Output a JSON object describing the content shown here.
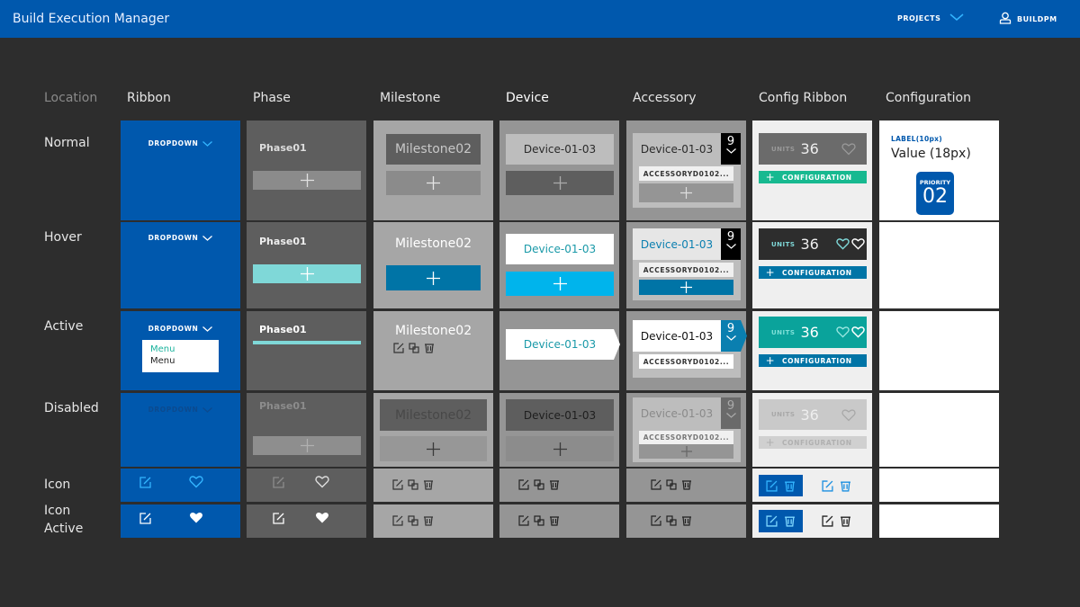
{
  "header": {
    "title": "Build Execution Manager",
    "projects_label": "PROJECTS",
    "user_label": "BUILDPM"
  },
  "columns": {
    "location": "Location",
    "ribbon": "Ribbon",
    "phase": "Phase",
    "milestone": "Milestone",
    "device": "Device",
    "accessory": "Accessory",
    "config_ribbon": "Config Ribbon",
    "configuration": "Configuration"
  },
  "rows": {
    "normal": "Normal",
    "hover": "Hover",
    "active": "Active",
    "disabled": "Disabled",
    "icon": "Icon",
    "icon_active_1": "Icon",
    "icon_active_2": "Active"
  },
  "ribbon": {
    "dropdown_label": "DROPDOWN",
    "menu_items": [
      "Menu",
      "Menu"
    ]
  },
  "phase": {
    "name": "Phase01"
  },
  "milestone": {
    "name": "Milestone02"
  },
  "device": {
    "name": "Device-01-03"
  },
  "accessory": {
    "device_name": "Device-01-03",
    "count": "9",
    "accessory_name": "ACCESSORYD0102..."
  },
  "config_ribbon": {
    "units_label": "UNITS",
    "units_value": "36",
    "config_button": "CONFIGURATION"
  },
  "configuration": {
    "label": "LABEL(10px)",
    "value": "Value (18px)",
    "priority_label": "PRIORITY",
    "priority_value": "02"
  },
  "colors": {
    "brand_blue": "#0058ad",
    "teal_hover": "#7fd8d8",
    "cyan": "#00b4ec",
    "ocean": "#0074a6",
    "green": "#17b990",
    "teal_active": "#0aa39b"
  }
}
